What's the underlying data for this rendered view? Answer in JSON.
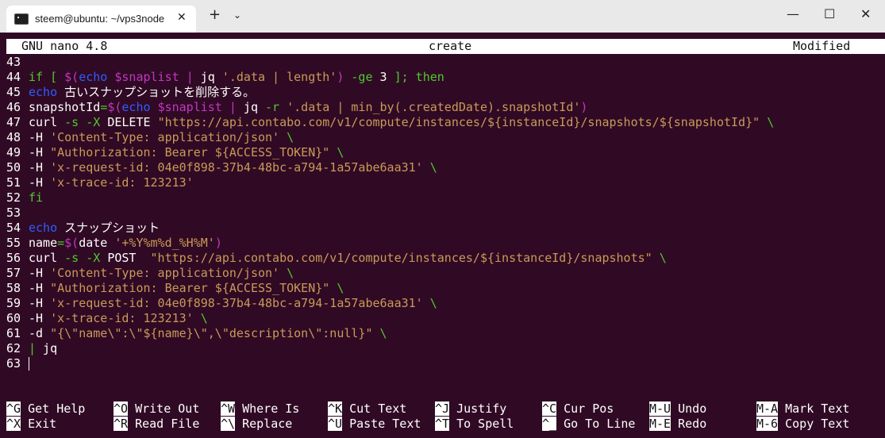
{
  "window": {
    "tab_title": "steem@ubuntu: ~/vps3node",
    "tab_close": "✕",
    "new_tab": "+",
    "dropdown": "⌄",
    "minimize": "—",
    "maximize": "☐",
    "close": "✕"
  },
  "nano": {
    "version": "GNU nano 4.8",
    "filename": "create",
    "status": "Modified"
  },
  "lines": [
    {
      "n": "43",
      "segs": []
    },
    {
      "n": "44",
      "segs": [
        {
          "c": "kw",
          "t": "if [ "
        },
        {
          "c": "op",
          "t": "$("
        },
        {
          "c": "bi",
          "t": "echo "
        },
        {
          "c": "var",
          "t": "$snaplist"
        },
        {
          "c": "",
          "t": " "
        },
        {
          "c": "op",
          "t": "|"
        },
        {
          "c": "",
          "t": " jq "
        },
        {
          "c": "str",
          "t": "'.data | length'"
        },
        {
          "c": "op",
          "t": ")"
        },
        {
          "c": "",
          "t": " "
        },
        {
          "c": "kw",
          "t": "-ge"
        },
        {
          "c": "",
          "t": " 3 "
        },
        {
          "c": "kw",
          "t": "]; then"
        }
      ]
    },
    {
      "n": "45",
      "segs": [
        {
          "c": "bi",
          "t": "echo"
        },
        {
          "c": "",
          "t": " 古いスナップショットを削除する。"
        }
      ]
    },
    {
      "n": "46",
      "segs": [
        {
          "c": "",
          "t": "snapshotId"
        },
        {
          "c": "kw",
          "t": "="
        },
        {
          "c": "op",
          "t": "$("
        },
        {
          "c": "bi",
          "t": "echo "
        },
        {
          "c": "var",
          "t": "$snaplist"
        },
        {
          "c": "",
          "t": " "
        },
        {
          "c": "op",
          "t": "|"
        },
        {
          "c": "",
          "t": " jq "
        },
        {
          "c": "kw",
          "t": "-r"
        },
        {
          "c": "",
          "t": " "
        },
        {
          "c": "str",
          "t": "'.data | min_by(.createdDate).snapshotId'"
        },
        {
          "c": "op",
          "t": ")"
        }
      ]
    },
    {
      "n": "47",
      "segs": [
        {
          "c": "",
          "t": "curl "
        },
        {
          "c": "kw",
          "t": "-s -X"
        },
        {
          "c": "",
          "t": " DELETE "
        },
        {
          "c": "str",
          "t": "\"https://api.contabo.com/v1/compute/instances/${instanceId}/snapshots/${snapshotId}\""
        },
        {
          "c": "",
          "t": " "
        },
        {
          "c": "kw",
          "t": "\\"
        }
      ]
    },
    {
      "n": "48",
      "segs": [
        {
          "c": "",
          "t": "-H "
        },
        {
          "c": "str",
          "t": "'Content-Type: application/json'"
        },
        {
          "c": "",
          "t": " "
        },
        {
          "c": "kw",
          "t": "\\"
        }
      ]
    },
    {
      "n": "49",
      "segs": [
        {
          "c": "",
          "t": "-H "
        },
        {
          "c": "str",
          "t": "\"Authorization: Bearer ${ACCESS_TOKEN}\""
        },
        {
          "c": "",
          "t": " "
        },
        {
          "c": "kw",
          "t": "\\"
        }
      ]
    },
    {
      "n": "50",
      "segs": [
        {
          "c": "",
          "t": "-H "
        },
        {
          "c": "str",
          "t": "'x-request-id: 04e0f898-37b4-48bc-a794-1a57abe6aa31'"
        },
        {
          "c": "",
          "t": " "
        },
        {
          "c": "kw",
          "t": "\\"
        }
      ]
    },
    {
      "n": "51",
      "segs": [
        {
          "c": "",
          "t": "-H "
        },
        {
          "c": "str",
          "t": "'x-trace-id: 123213'"
        }
      ]
    },
    {
      "n": "52",
      "segs": [
        {
          "c": "kw",
          "t": "fi"
        }
      ]
    },
    {
      "n": "53",
      "segs": []
    },
    {
      "n": "54",
      "segs": [
        {
          "c": "bi",
          "t": "echo"
        },
        {
          "c": "",
          "t": " スナップショット"
        }
      ]
    },
    {
      "n": "55",
      "segs": [
        {
          "c": "",
          "t": "name"
        },
        {
          "c": "kw",
          "t": "="
        },
        {
          "c": "op",
          "t": "$("
        },
        {
          "c": "",
          "t": "date "
        },
        {
          "c": "str",
          "t": "'+%Y%m%d_%H%M'"
        },
        {
          "c": "op",
          "t": ")"
        }
      ]
    },
    {
      "n": "56",
      "segs": [
        {
          "c": "",
          "t": "curl "
        },
        {
          "c": "kw",
          "t": "-s -X"
        },
        {
          "c": "",
          "t": " POST  "
        },
        {
          "c": "str",
          "t": "\"https://api.contabo.com/v1/compute/instances/${instanceId}/snapshots\""
        },
        {
          "c": "",
          "t": " "
        },
        {
          "c": "kw",
          "t": "\\"
        }
      ]
    },
    {
      "n": "57",
      "segs": [
        {
          "c": "",
          "t": "-H "
        },
        {
          "c": "str",
          "t": "'Content-Type: application/json'"
        },
        {
          "c": "",
          "t": " "
        },
        {
          "c": "kw",
          "t": "\\"
        }
      ]
    },
    {
      "n": "58",
      "segs": [
        {
          "c": "",
          "t": "-H "
        },
        {
          "c": "str",
          "t": "\"Authorization: Bearer ${ACCESS_TOKEN}\""
        },
        {
          "c": "",
          "t": " "
        },
        {
          "c": "kw",
          "t": "\\"
        }
      ]
    },
    {
      "n": "59",
      "segs": [
        {
          "c": "",
          "t": "-H "
        },
        {
          "c": "str",
          "t": "'x-request-id: 04e0f898-37b4-48bc-a794-1a57abe6aa31'"
        },
        {
          "c": "",
          "t": " "
        },
        {
          "c": "kw",
          "t": "\\"
        }
      ]
    },
    {
      "n": "60",
      "segs": [
        {
          "c": "",
          "t": "-H "
        },
        {
          "c": "str",
          "t": "'x-trace-id: 123213'"
        },
        {
          "c": "",
          "t": " "
        },
        {
          "c": "kw",
          "t": "\\"
        }
      ]
    },
    {
      "n": "61",
      "segs": [
        {
          "c": "",
          "t": "-d "
        },
        {
          "c": "str",
          "t": "\"{\\\"name\\\":\\\"${name}\\\",\\\"description\\\":null}\""
        },
        {
          "c": "",
          "t": " "
        },
        {
          "c": "kw",
          "t": "\\"
        }
      ]
    },
    {
      "n": "62",
      "segs": [
        {
          "c": "kw",
          "t": "|"
        },
        {
          "c": "",
          "t": " jq"
        }
      ]
    },
    {
      "n": "63",
      "segs": [],
      "cursor": true
    }
  ],
  "shortcuts": [
    {
      "key": "^G",
      "label": "Get Help"
    },
    {
      "key": "^O",
      "label": "Write Out"
    },
    {
      "key": "^W",
      "label": "Where Is"
    },
    {
      "key": "^K",
      "label": "Cut Text"
    },
    {
      "key": "^J",
      "label": "Justify"
    },
    {
      "key": "^C",
      "label": "Cur Pos"
    },
    {
      "key": "M-U",
      "label": "Undo"
    },
    {
      "key": "M-A",
      "label": "Mark Text"
    },
    {
      "key": "^X",
      "label": "Exit"
    },
    {
      "key": "^R",
      "label": "Read File"
    },
    {
      "key": "^\\",
      "label": "Replace"
    },
    {
      "key": "^U",
      "label": "Paste Text"
    },
    {
      "key": "^T",
      "label": "To Spell"
    },
    {
      "key": "^_",
      "label": "Go To Line"
    },
    {
      "key": "M-E",
      "label": "Redo"
    },
    {
      "key": "M-6",
      "label": "Copy Text"
    }
  ],
  "colors": {
    "background": "#300a24",
    "keyword": "#4ec92f",
    "builtin": "#2f5cff",
    "variable": "#c236c2",
    "string": "#c99a58"
  }
}
